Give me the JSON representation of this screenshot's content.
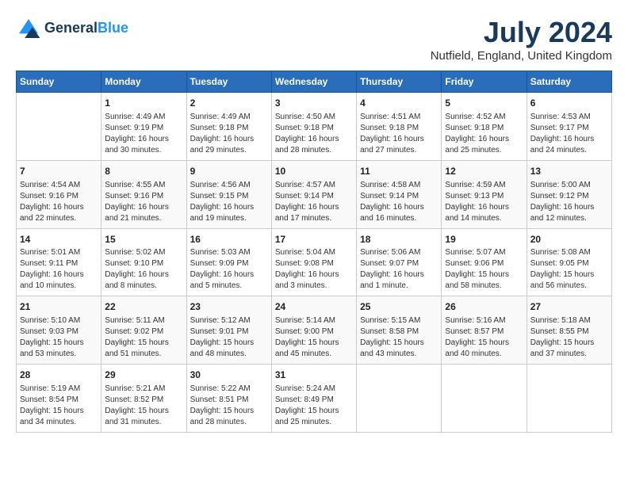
{
  "header": {
    "logo_line1": "General",
    "logo_line2": "Blue",
    "month_year": "July 2024",
    "location": "Nutfield, England, United Kingdom"
  },
  "days_of_week": [
    "Sunday",
    "Monday",
    "Tuesday",
    "Wednesday",
    "Thursday",
    "Friday",
    "Saturday"
  ],
  "weeks": [
    [
      {
        "day": "",
        "info": ""
      },
      {
        "day": "1",
        "info": "Sunrise: 4:49 AM\nSunset: 9:19 PM\nDaylight: 16 hours\nand 30 minutes."
      },
      {
        "day": "2",
        "info": "Sunrise: 4:49 AM\nSunset: 9:18 PM\nDaylight: 16 hours\nand 29 minutes."
      },
      {
        "day": "3",
        "info": "Sunrise: 4:50 AM\nSunset: 9:18 PM\nDaylight: 16 hours\nand 28 minutes."
      },
      {
        "day": "4",
        "info": "Sunrise: 4:51 AM\nSunset: 9:18 PM\nDaylight: 16 hours\nand 27 minutes."
      },
      {
        "day": "5",
        "info": "Sunrise: 4:52 AM\nSunset: 9:18 PM\nDaylight: 16 hours\nand 25 minutes."
      },
      {
        "day": "6",
        "info": "Sunrise: 4:53 AM\nSunset: 9:17 PM\nDaylight: 16 hours\nand 24 minutes."
      }
    ],
    [
      {
        "day": "7",
        "info": "Sunrise: 4:54 AM\nSunset: 9:16 PM\nDaylight: 16 hours\nand 22 minutes."
      },
      {
        "day": "8",
        "info": "Sunrise: 4:55 AM\nSunset: 9:16 PM\nDaylight: 16 hours\nand 21 minutes."
      },
      {
        "day": "9",
        "info": "Sunrise: 4:56 AM\nSunset: 9:15 PM\nDaylight: 16 hours\nand 19 minutes."
      },
      {
        "day": "10",
        "info": "Sunrise: 4:57 AM\nSunset: 9:14 PM\nDaylight: 16 hours\nand 17 minutes."
      },
      {
        "day": "11",
        "info": "Sunrise: 4:58 AM\nSunset: 9:14 PM\nDaylight: 16 hours\nand 16 minutes."
      },
      {
        "day": "12",
        "info": "Sunrise: 4:59 AM\nSunset: 9:13 PM\nDaylight: 16 hours\nand 14 minutes."
      },
      {
        "day": "13",
        "info": "Sunrise: 5:00 AM\nSunset: 9:12 PM\nDaylight: 16 hours\nand 12 minutes."
      }
    ],
    [
      {
        "day": "14",
        "info": "Sunrise: 5:01 AM\nSunset: 9:11 PM\nDaylight: 16 hours\nand 10 minutes."
      },
      {
        "day": "15",
        "info": "Sunrise: 5:02 AM\nSunset: 9:10 PM\nDaylight: 16 hours\nand 8 minutes."
      },
      {
        "day": "16",
        "info": "Sunrise: 5:03 AM\nSunset: 9:09 PM\nDaylight: 16 hours\nand 5 minutes."
      },
      {
        "day": "17",
        "info": "Sunrise: 5:04 AM\nSunset: 9:08 PM\nDaylight: 16 hours\nand 3 minutes."
      },
      {
        "day": "18",
        "info": "Sunrise: 5:06 AM\nSunset: 9:07 PM\nDaylight: 16 hours\nand 1 minute."
      },
      {
        "day": "19",
        "info": "Sunrise: 5:07 AM\nSunset: 9:06 PM\nDaylight: 15 hours\nand 58 minutes."
      },
      {
        "day": "20",
        "info": "Sunrise: 5:08 AM\nSunset: 9:05 PM\nDaylight: 15 hours\nand 56 minutes."
      }
    ],
    [
      {
        "day": "21",
        "info": "Sunrise: 5:10 AM\nSunset: 9:03 PM\nDaylight: 15 hours\nand 53 minutes."
      },
      {
        "day": "22",
        "info": "Sunrise: 5:11 AM\nSunset: 9:02 PM\nDaylight: 15 hours\nand 51 minutes."
      },
      {
        "day": "23",
        "info": "Sunrise: 5:12 AM\nSunset: 9:01 PM\nDaylight: 15 hours\nand 48 minutes."
      },
      {
        "day": "24",
        "info": "Sunrise: 5:14 AM\nSunset: 9:00 PM\nDaylight: 15 hours\nand 45 minutes."
      },
      {
        "day": "25",
        "info": "Sunrise: 5:15 AM\nSunset: 8:58 PM\nDaylight: 15 hours\nand 43 minutes."
      },
      {
        "day": "26",
        "info": "Sunrise: 5:16 AM\nSunset: 8:57 PM\nDaylight: 15 hours\nand 40 minutes."
      },
      {
        "day": "27",
        "info": "Sunrise: 5:18 AM\nSunset: 8:55 PM\nDaylight: 15 hours\nand 37 minutes."
      }
    ],
    [
      {
        "day": "28",
        "info": "Sunrise: 5:19 AM\nSunset: 8:54 PM\nDaylight: 15 hours\nand 34 minutes."
      },
      {
        "day": "29",
        "info": "Sunrise: 5:21 AM\nSunset: 8:52 PM\nDaylight: 15 hours\nand 31 minutes."
      },
      {
        "day": "30",
        "info": "Sunrise: 5:22 AM\nSunset: 8:51 PM\nDaylight: 15 hours\nand 28 minutes."
      },
      {
        "day": "31",
        "info": "Sunrise: 5:24 AM\nSunset: 8:49 PM\nDaylight: 15 hours\nand 25 minutes."
      },
      {
        "day": "",
        "info": ""
      },
      {
        "day": "",
        "info": ""
      },
      {
        "day": "",
        "info": ""
      }
    ]
  ]
}
